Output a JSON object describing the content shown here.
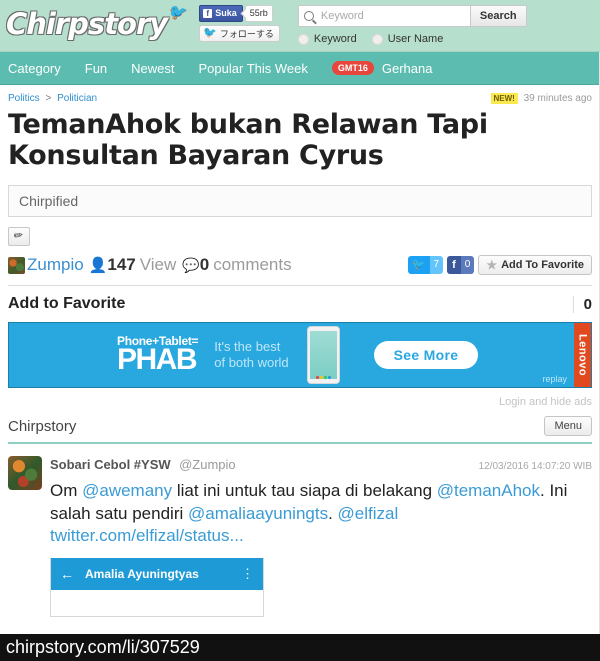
{
  "header": {
    "logo_text": "Chirpstory",
    "facebook_like_label": "Suka",
    "facebook_like_count": "55rb",
    "twitter_follow_label": "フォローする",
    "search_placeholder": "Keyword",
    "search_value": "",
    "search_button": "Search",
    "radio_keyword": "Keyword",
    "radio_username": "User Name"
  },
  "nav": {
    "items": [
      {
        "label": "Category"
      },
      {
        "label": "Fun"
      },
      {
        "label": "Newest"
      },
      {
        "label": "Popular This Week"
      }
    ],
    "gmt_badge": "GMT16",
    "gmt_label": "Gerhana"
  },
  "breadcrumb": {
    "parent": "Politics",
    "separator": ">",
    "child": "Politician"
  },
  "meta": {
    "new_badge": "NEW!",
    "time_ago": "39 minutes ago"
  },
  "story": {
    "title": "TemanAhok bukan Relawan Tapi Konsultan Bayaran Cyrus",
    "chirpified_label": "Chirpified",
    "author": "Zumpio",
    "view_count": "147",
    "view_label": "View",
    "comment_count": "0",
    "comment_label": "comments"
  },
  "share": {
    "twitter_count": "7",
    "facebook_count": "0",
    "favorite_label": "Add To Favorite"
  },
  "favorite_bar": {
    "title": "Add to Favorite",
    "count": "0"
  },
  "ad": {
    "headline_small": "Phone+Tablet=",
    "headline_big": "PHAB",
    "tagline_line1": "It's the best",
    "tagline_line2": "of both world",
    "cta": "See More",
    "replay": "replay",
    "brand": "Lenovo"
  },
  "login_hide_ads": "Login and hide ads",
  "chirp_section": {
    "title": "Chirpstory",
    "menu_label": "Menu"
  },
  "tweet": {
    "name": "Sobari Cebol #YSW",
    "handle": "@Zumpio",
    "timestamp": "12/03/2016 14:07:20 WIB",
    "text_parts": [
      {
        "type": "text",
        "value": "Om "
      },
      {
        "type": "mention",
        "value": "@awemany"
      },
      {
        "type": "text",
        "value": " liat ini untuk tau siapa di belakang "
      },
      {
        "type": "mention",
        "value": "@temanAhok"
      },
      {
        "type": "text",
        "value": ". Ini salah satu pendiri "
      },
      {
        "type": "mention",
        "value": "@amaliaayuningts"
      },
      {
        "type": "text",
        "value": ". "
      },
      {
        "type": "mention",
        "value": "@elfizal"
      },
      {
        "type": "text",
        "value": "  "
      },
      {
        "type": "mention",
        "value": "twitter.com/elfizal/status..."
      }
    ],
    "card": {
      "back_icon": "←",
      "title": "Amalia Ayuningtyas",
      "kebab_icon": "⋮"
    }
  },
  "url_bar": {
    "url": "chirpstory.com/li/307529"
  },
  "colors": {
    "header_bg": "#b6dfcd",
    "nav_bg": "#5cbcb0",
    "link_blue": "#3a8fd0",
    "mention_blue": "#3a9bd5",
    "ad_blue": "#29a8e0",
    "lenovo_orange": "#e1491f",
    "gmt_red": "#e8453c",
    "new_yellow": "#f9e84f"
  }
}
